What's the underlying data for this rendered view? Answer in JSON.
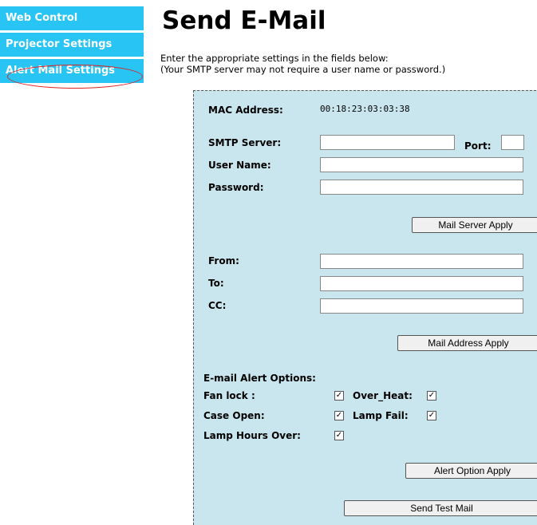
{
  "sidebar": {
    "items": [
      {
        "label": "Web Control"
      },
      {
        "label": "Projector Settings"
      },
      {
        "label": "Alert Mail Settings"
      }
    ]
  },
  "header": {
    "title": "Send E-Mail",
    "instruction_line1": "Enter the appropriate settings in the fields below:",
    "instruction_line2": "(Your SMTP server may not require a user name or password.)"
  },
  "server": {
    "mac_label": "MAC Address:",
    "mac_value": "00:18:23:03:03:38",
    "smtp_label": "SMTP Server:",
    "smtp_value": "",
    "port_label": "Port:",
    "port_value": "",
    "user_label": "User Name:",
    "user_value": "",
    "password_label": "Password:",
    "password_value": "",
    "apply_label": "Mail Server Apply"
  },
  "addresses": {
    "from_label": "From:",
    "from_value": "",
    "to_label": "To:",
    "to_value": "",
    "cc_label": "CC:",
    "cc_value": "",
    "apply_label": "Mail Address Apply"
  },
  "alerts": {
    "heading": "E-mail Alert Options:",
    "fan_lock_label": "Fan lock :",
    "fan_lock_checked": true,
    "over_heat_label": "Over_Heat:",
    "over_heat_checked": true,
    "case_open_label": "Case Open:",
    "case_open_checked": true,
    "lamp_fail_label": "Lamp Fail:",
    "lamp_fail_checked": true,
    "lamp_hours_label": "Lamp Hours Over:",
    "lamp_hours_checked": true,
    "apply_label": "Alert Option Apply",
    "test_label": "Send Test Mail",
    "check_glyph": "✓"
  }
}
